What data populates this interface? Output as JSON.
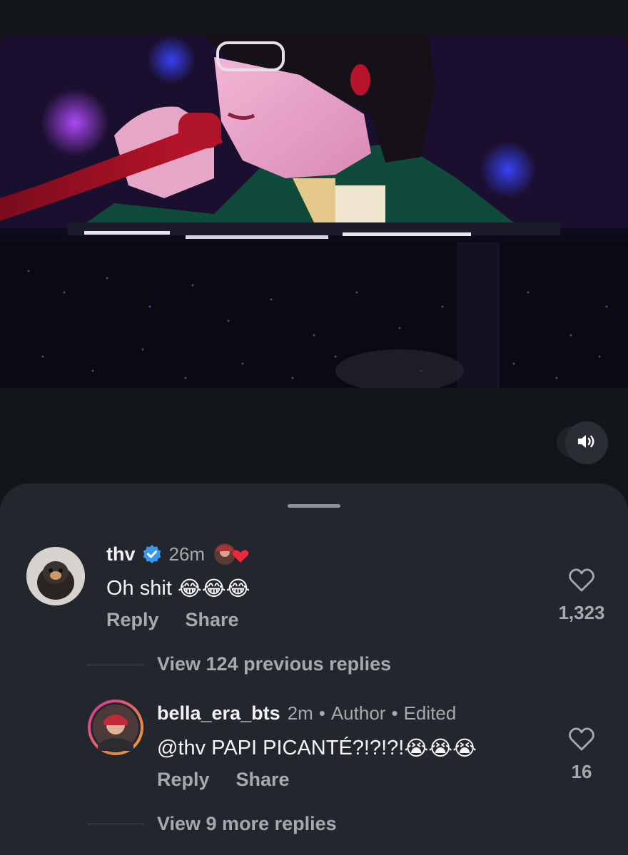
{
  "controls": {
    "mute_icon": "speaker-icon"
  },
  "comments": [
    {
      "username": "thv",
      "verified": true,
      "time": "26m",
      "text": "Oh shit",
      "emoji": "😂😂😂",
      "reply_label": "Reply",
      "share_label": "Share",
      "likes": "1,323",
      "view_replies": "View 124 previous replies"
    },
    {
      "username": "bella_era_bts",
      "time": "2m",
      "sep": "•",
      "author_label": "Author",
      "edited_label": "Edited",
      "mention": "@thv",
      "text": "PAPI PICANTÉ?!?!?!",
      "emoji": "😭😭😭",
      "reply_label": "Reply",
      "share_label": "Share",
      "likes": "16",
      "view_replies": "View 9 more replies"
    }
  ]
}
